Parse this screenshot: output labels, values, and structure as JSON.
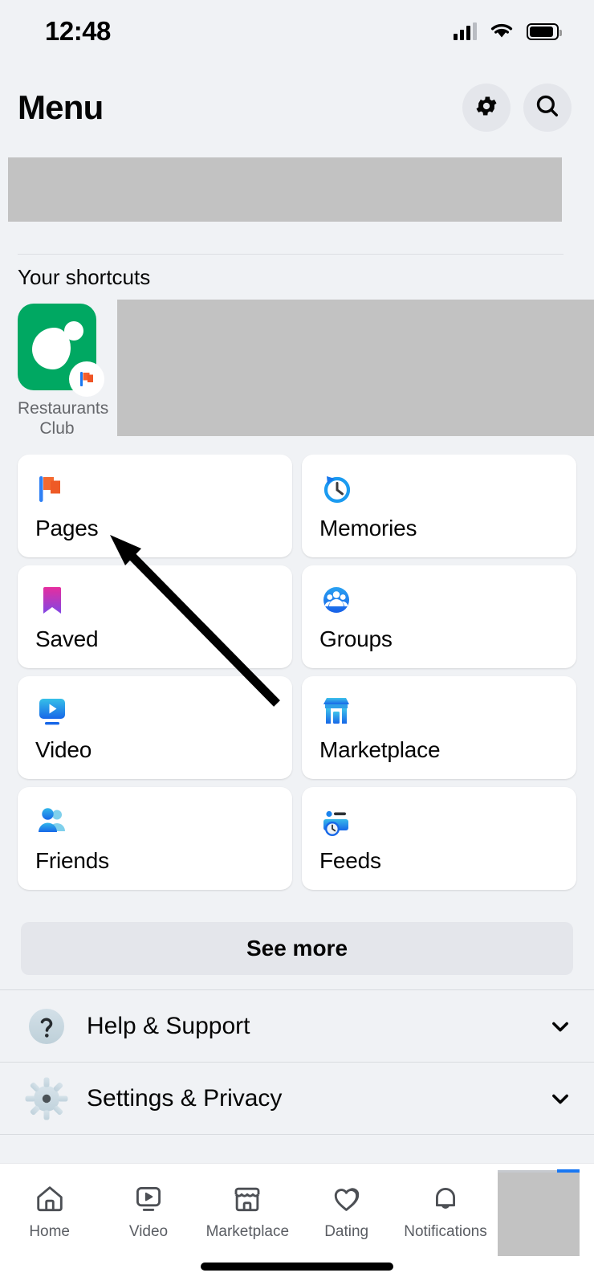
{
  "statusbar": {
    "time": "12:48",
    "signal_icon": "cellular-signal-icon",
    "wifi_icon": "wifi-icon",
    "battery_icon": "battery-icon"
  },
  "header": {
    "title": "Menu",
    "settings_icon": "gear-icon",
    "search_icon": "search-icon"
  },
  "shortcuts": {
    "section_title": "Your shortcuts",
    "items": [
      {
        "label": "Restaurants Club",
        "icon": "restaurants-club-avatar",
        "badge_icon": "flag-badge-icon"
      }
    ]
  },
  "grid": {
    "cards": [
      {
        "label": "Pages",
        "icon": "pages-flag-icon"
      },
      {
        "label": "Memories",
        "icon": "memories-clock-icon"
      },
      {
        "label": "Saved",
        "icon": "saved-bookmark-icon"
      },
      {
        "label": "Groups",
        "icon": "groups-people-icon"
      },
      {
        "label": "Video",
        "icon": "video-play-icon"
      },
      {
        "label": "Marketplace",
        "icon": "marketplace-store-icon"
      },
      {
        "label": "Friends",
        "icon": "friends-people-icon"
      },
      {
        "label": "Feeds",
        "icon": "feeds-card-clock-icon"
      }
    ],
    "see_more_label": "See more"
  },
  "accordion": {
    "rows": [
      {
        "label": "Help & Support",
        "icon": "question-mark-icon",
        "chevron": "chevron-down-icon"
      },
      {
        "label": "Settings & Privacy",
        "icon": "gear-icon",
        "chevron": "chevron-down-icon"
      }
    ]
  },
  "tabbar": {
    "tabs": [
      {
        "label": "Home",
        "icon": "home-icon"
      },
      {
        "label": "Video",
        "icon": "video-icon"
      },
      {
        "label": "Marketplace",
        "icon": "storefront-icon"
      },
      {
        "label": "Dating",
        "icon": "dating-hearts-icon"
      },
      {
        "label": "Notifications",
        "icon": "bell-icon"
      }
    ],
    "active_indicator_color": "#1877f2"
  },
  "colors": {
    "background": "#f0f2f5",
    "card": "#ffffff",
    "accent_blue": "#1877f2",
    "pages_orange": "#f4603b",
    "saved_pink": "#e0339e",
    "saved_purple": "#8a4ae8",
    "shortcut_green": "#00a862",
    "text_primary": "#050505",
    "text_secondary": "#65676b",
    "redacted_gray": "#c2c2c2"
  },
  "annotation": {
    "arrow_name": "pointer-arrow",
    "points_to": "Pages"
  }
}
